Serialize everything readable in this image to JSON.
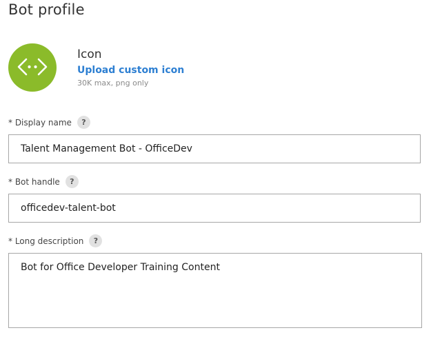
{
  "page": {
    "title": "Bot profile"
  },
  "icon_section": {
    "title": "Icon",
    "upload_label": "Upload custom icon",
    "hint": "30K max, png only",
    "icon_name": "code-brackets-icon",
    "icon_color": "#8bbb2a"
  },
  "fields": {
    "display_name": {
      "label": "* Display name",
      "help": "?",
      "value": "Talent Management Bot - OfficeDev"
    },
    "bot_handle": {
      "label": "* Bot handle",
      "help": "?",
      "value": "officedev-talent-bot"
    },
    "long_description": {
      "label": "* Long description",
      "help": "?",
      "value": "Bot for Office Developer Training Content"
    }
  },
  "colors": {
    "link": "#2d7fd2",
    "border": "#a6a6a6"
  }
}
